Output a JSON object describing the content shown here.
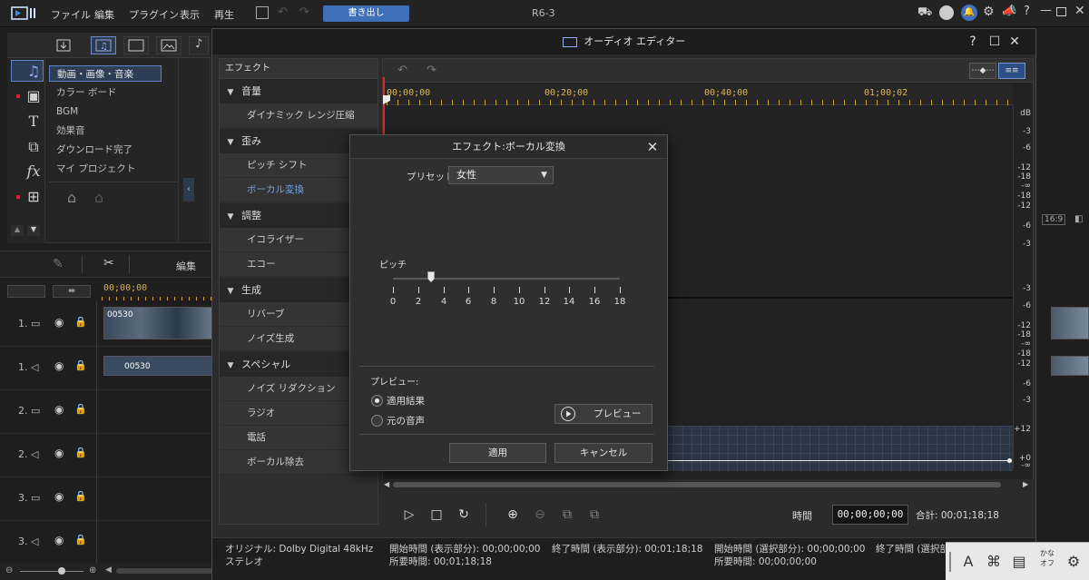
{
  "app": {
    "menu": [
      "ファイル",
      "編集",
      "プラグイン",
      "表示",
      "再生"
    ],
    "export_label": "書き出し",
    "project_title": "R6-3"
  },
  "library": {
    "categories": [
      "動画・画像・音楽",
      "カラー ボード",
      "BGM",
      "効果音",
      "ダウンロード完了",
      "マイ プロジェクト"
    ],
    "active_category": 0
  },
  "timeline": {
    "edit_label": "編集",
    "timecode": "00;00;00",
    "tracks": [
      {
        "label": "1.",
        "kind": "video"
      },
      {
        "label": "1.",
        "kind": "audio"
      },
      {
        "label": "2.",
        "kind": "video"
      },
      {
        "label": "2.",
        "kind": "audio"
      },
      {
        "label": "3.",
        "kind": "video"
      },
      {
        "label": "3.",
        "kind": "audio"
      }
    ],
    "clip_label_1": "00530",
    "clip_label_2": "00530",
    "aspect": "16:9"
  },
  "audio_editor": {
    "title": "オーディオ エディター",
    "effects_header": "エフェクト",
    "groups": [
      {
        "name": "音量",
        "items": [
          "ダイナミック レンジ圧縮"
        ]
      },
      {
        "name": "歪み",
        "items": [
          "ピッチ シフト",
          "ボーカル変換"
        ]
      },
      {
        "name": "調整",
        "items": [
          "イコライザー",
          "エコー"
        ]
      },
      {
        "name": "生成",
        "items": [
          "リバーブ",
          "ノイズ生成"
        ]
      },
      {
        "name": "スペシャル",
        "items": [
          "ノイズ リダクション",
          "ラジオ",
          "電話",
          "ボーカル除去"
        ]
      }
    ],
    "active_item": "ボーカル変換",
    "ruler": [
      "00;00;00",
      "00;20;00",
      "00;40;00",
      "01;00;02"
    ],
    "db_unit": "dB",
    "db_top": [
      "-3",
      "-6",
      "-12",
      "-18",
      "-∞",
      "-18",
      "-12",
      "-6",
      "-3"
    ],
    "db_bottom": [
      "-3",
      "-6",
      "-12",
      "-18",
      "-∞",
      "-18",
      "-12",
      "-6",
      "-3"
    ],
    "graph_top": "+12",
    "graph_zero": "+0",
    "graph_bottom": "-∞",
    "time_label": "時間",
    "time_value": "00;00;00;00",
    "total_label": "合計: 00;01;18;18",
    "status": {
      "original": "オリジナル: Dolby Digital 48kHz",
      "channels": "ステレオ",
      "start_display": "開始時間 (表示部分): 00;00;00;00",
      "end_display": "終了時間 (表示部分): 00;01;18;18",
      "duration_display": "所要時間: 00;01;18;18",
      "start_selection": "開始時間 (選択部分): 00;00;00;00",
      "end_selection": "終了時間 (選択部分",
      "duration_selection": "所要時間: 00;00;00;00"
    }
  },
  "vocal_dialog": {
    "title": "エフェクト:ボーカル変換",
    "preset_label": "プリセット:",
    "preset_value": "女性",
    "pitch_label": "ピッチ",
    "pitch_value": 3,
    "ticks": [
      "0",
      "2",
      "4",
      "6",
      "8",
      "10",
      "12",
      "14",
      "16",
      "18"
    ],
    "preview_section": "プレビュー:",
    "radio_result": "適用結果",
    "radio_original": "元の音声",
    "radio_selected": "適用結果",
    "preview_button": "プレビュー",
    "apply_button": "適用",
    "cancel_button": "キャンセル"
  },
  "ime": {
    "mode": "A",
    "kana_top": "かな",
    "kana_bottom": "オフ"
  }
}
